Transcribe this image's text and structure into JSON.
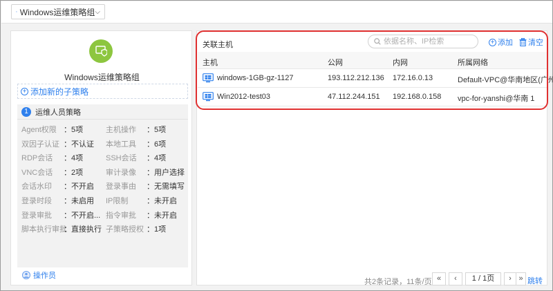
{
  "topbar": {
    "group_select": "Windows运维策略组"
  },
  "left": {
    "group_name": "Windows运维策略组",
    "add_sub_policy": "添加新的子策略",
    "policy": {
      "index": "1",
      "title": "运维人员策略",
      "items": [
        {
          "label": "Agent权限",
          "value": "：5项"
        },
        {
          "label": "主机操作",
          "value": "：5项"
        },
        {
          "label": "双因子认证",
          "value": "：不认证"
        },
        {
          "label": "本地工具",
          "value": "：6项"
        },
        {
          "label": "RDP会话",
          "value": "：4项"
        },
        {
          "label": "SSH会话",
          "value": "：4项"
        },
        {
          "label": "VNC会话",
          "value": "：2项"
        },
        {
          "label": "审计录像",
          "value": "：用户选择"
        },
        {
          "label": "会话水印",
          "value": "：不开启"
        },
        {
          "label": "登录事由",
          "value": "：无需填写"
        },
        {
          "label": "登录时段",
          "value": "：未启用"
        },
        {
          "label": "IP限制",
          "value": "：未开启"
        },
        {
          "label": "登录审批",
          "value": "：不开启..."
        },
        {
          "label": "指令审批",
          "value": "：未开启"
        },
        {
          "label": "脚本执行审批",
          "value": "：直接执行"
        },
        {
          "label": "子策略授权",
          "value": "：1项"
        }
      ]
    },
    "operator": "操作员"
  },
  "right": {
    "assoc_label": "关联主机",
    "search_placeholder": "依据名称、IP检索",
    "add": "添加",
    "clear": "清空",
    "columns": [
      "主机",
      "公网",
      "内网",
      "所属网络"
    ],
    "rows": [
      {
        "host": "windows-1GB-gz-1127",
        "public": "193.112.212.136",
        "private": "172.16.0.13",
        "network": "Default-VPC@华南地区(广州)"
      },
      {
        "host": "Win2012-test03",
        "public": "47.112.244.151",
        "private": "192.168.0.158",
        "network": "vpc-for-yanshi@华南 1"
      }
    ],
    "pager": {
      "info": "共2条记录，11条/页",
      "first": "«",
      "prev": "‹",
      "page": "1 / 1页",
      "next": "›",
      "last": "»",
      "jump": "跳转"
    }
  },
  "colors": {
    "accent": "#2f80ed",
    "shield": "#8dc63f",
    "highlight": "#e03030"
  }
}
